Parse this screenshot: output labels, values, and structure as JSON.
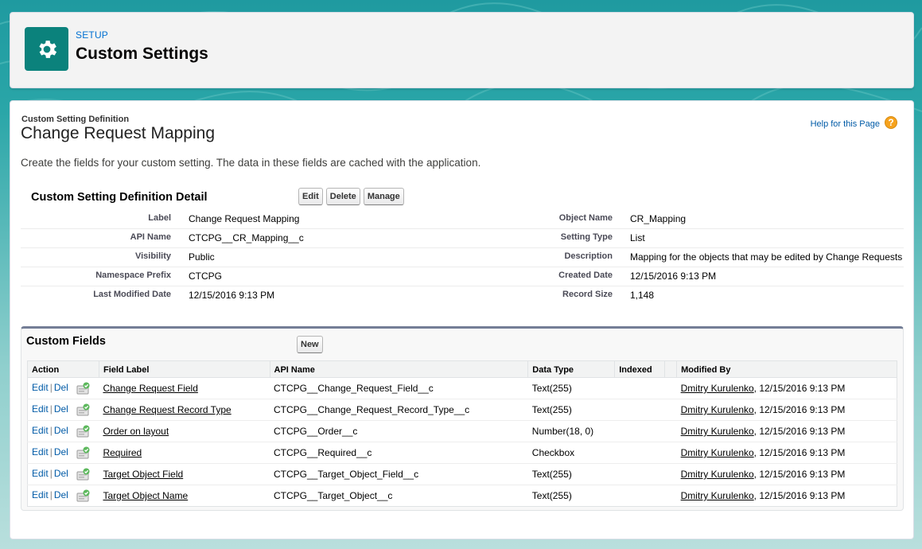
{
  "header": {
    "eyebrow": "SETUP",
    "title": "Custom Settings",
    "icon": "gear-icon",
    "icon_color": "#0b827c"
  },
  "definition": {
    "type_label": "Custom Setting Definition",
    "name": "Change Request Mapping",
    "help_link": "Help for this Page",
    "description": "Create the fields for your custom setting. The data in these fields are cached with the application."
  },
  "detail": {
    "title": "Custom Setting Definition Detail",
    "buttons": {
      "edit": "Edit",
      "delete": "Delete",
      "manage": "Manage"
    },
    "rows": [
      {
        "l1": "Label",
        "v1": "Change Request Mapping",
        "l2": "Object Name",
        "v2": "CR_Mapping"
      },
      {
        "l1": "API Name",
        "v1": "CTCPG__CR_Mapping__c",
        "l2": "Setting Type",
        "v2": "List"
      },
      {
        "l1": "Visibility",
        "v1": "Public",
        "l2": "Description",
        "v2": "Mapping for the objects that may be edited by Change Requests"
      },
      {
        "l1": "Namespace Prefix",
        "v1": "CTCPG",
        "l2": "Created Date",
        "v2": "12/15/2016 9:13 PM"
      },
      {
        "l1": "Last Modified Date",
        "v1": "12/15/2016 9:13 PM",
        "l2": "Record Size",
        "v2": "1,148"
      }
    ]
  },
  "fields": {
    "title": "Custom Fields",
    "new_button": "New",
    "columns": [
      "Action",
      "Field Label",
      "API Name",
      "Data Type",
      "Indexed",
      "Modified By"
    ],
    "edit_label": "Edit",
    "del_label": "Del",
    "sep": "|",
    "rows": [
      {
        "label": "Change Request Field",
        "api": "CTCPG__Change_Request_Field__c",
        "type": "Text(255)",
        "indexed": "",
        "modified_by": "Dmitry Kurulenko",
        "modified_date": ", 12/15/2016 9:13 PM"
      },
      {
        "label": "Change Request Record Type",
        "api": "CTCPG__Change_Request_Record_Type__c",
        "type": "Text(255)",
        "indexed": "",
        "modified_by": "Dmitry Kurulenko",
        "modified_date": ", 12/15/2016 9:13 PM"
      },
      {
        "label": "Order on layout",
        "api": "CTCPG__Order__c",
        "type": "Number(18, 0)",
        "indexed": "",
        "modified_by": "Dmitry Kurulenko",
        "modified_date": ", 12/15/2016 9:13 PM"
      },
      {
        "label": "Required",
        "api": "CTCPG__Required__c",
        "type": "Checkbox",
        "indexed": "",
        "modified_by": "Dmitry Kurulenko",
        "modified_date": ", 12/15/2016 9:13 PM"
      },
      {
        "label": "Target Object Field",
        "api": "CTCPG__Target_Object_Field__c",
        "type": "Text(255)",
        "indexed": "",
        "modified_by": "Dmitry Kurulenko",
        "modified_date": ", 12/15/2016 9:13 PM"
      },
      {
        "label": "Target Object Name",
        "api": "CTCPG__Target_Object__c",
        "type": "Text(255)",
        "indexed": "",
        "modified_by": "Dmitry Kurulenko",
        "modified_date": ", 12/15/2016 9:13 PM"
      }
    ]
  }
}
